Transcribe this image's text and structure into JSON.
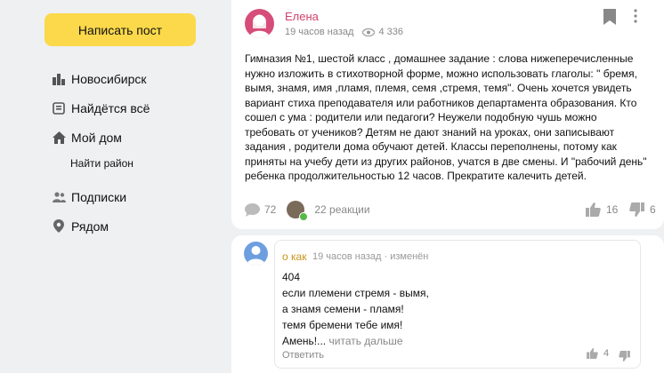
{
  "sidebar": {
    "write_post": "Написать пост",
    "items": [
      {
        "label": "Новосибирск",
        "icon": "city-icon"
      },
      {
        "label": "Найдётся всё",
        "icon": "board-icon"
      },
      {
        "label": "Мой дом",
        "icon": "home-icon"
      }
    ],
    "sub_item": "Найти район",
    "items2": [
      {
        "label": "Подписки",
        "icon": "people-icon"
      },
      {
        "label": "Рядом",
        "icon": "location-pin-icon"
      }
    ]
  },
  "post": {
    "author": "Елена",
    "time": "19 часов назад",
    "views": "4 336",
    "text": "Гимназия №1, шестой класс , домашнее задание : слова нижеперечисленные нужно изложить в стихотворной форме, можно использовать глаголы: \" бремя, вымя, знамя, имя ,пламя, племя, семя ,стремя, темя\". Очень хочется увидеть вариант стиха преподавателя или работников департамента образования. Кто сошел с ума : родители или педагоги? Неужели подобную чушь можно требовать от учеников? Детям не дают знаний на уроках, они записывают задания , родители дома обучают детей. Классы переполнены, потому как приняты на учебу дети из других районов, учатся в две смены. И \"рабочий день\" ребенка продолжительностью 12 часов. Прекратите калечить детей.",
    "comments": "72",
    "reactions": "22 реакции",
    "likes": "16",
    "dislikes": "6"
  },
  "comment": {
    "author": "о как",
    "meta": "19 часов назад · изменён",
    "lines": [
      "404",
      "если племени стремя - вымя,",
      "а знамя семени - пламя!",
      "темя бремени тебе имя!",
      "Амень!..."
    ],
    "read_more": "читать дальше",
    "reply": "Ответить",
    "likes": "4"
  },
  "colors": {
    "accent_button": "#fbd94a",
    "author_post": "#d1436d",
    "author_comment": "#c7941a"
  }
}
